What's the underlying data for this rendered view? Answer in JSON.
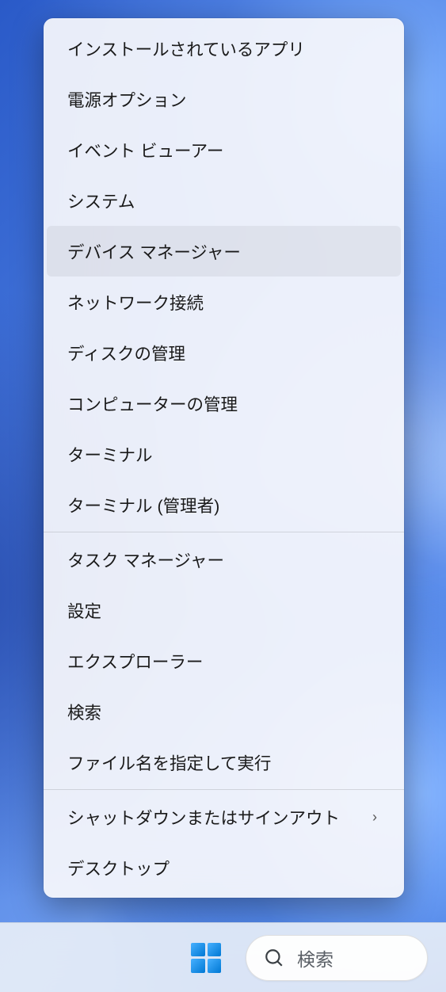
{
  "context_menu": {
    "groups": [
      [
        {
          "id": "installed-apps",
          "label": "インストールされているアプリ"
        },
        {
          "id": "power-options",
          "label": "電源オプション"
        },
        {
          "id": "event-viewer",
          "label": "イベント ビューアー"
        },
        {
          "id": "system",
          "label": "システム"
        },
        {
          "id": "device-manager",
          "label": "デバイス マネージャー",
          "hovered": true
        },
        {
          "id": "network-conns",
          "label": "ネットワーク接続"
        },
        {
          "id": "disk-mgmt",
          "label": "ディスクの管理"
        },
        {
          "id": "computer-mgmt",
          "label": "コンピューターの管理"
        },
        {
          "id": "terminal",
          "label": "ターミナル"
        },
        {
          "id": "terminal-admin",
          "label": "ターミナル (管理者)"
        }
      ],
      [
        {
          "id": "task-manager",
          "label": "タスク マネージャー"
        },
        {
          "id": "settings",
          "label": "設定"
        },
        {
          "id": "explorer",
          "label": "エクスプローラー"
        },
        {
          "id": "search",
          "label": "検索"
        },
        {
          "id": "run",
          "label": "ファイル名を指定して実行"
        }
      ],
      [
        {
          "id": "shutdown-signout",
          "label": "シャットダウンまたはサインアウト",
          "has_submenu": true
        },
        {
          "id": "desktop",
          "label": "デスクトップ"
        }
      ]
    ]
  },
  "taskbar": {
    "search_placeholder": "検索"
  }
}
